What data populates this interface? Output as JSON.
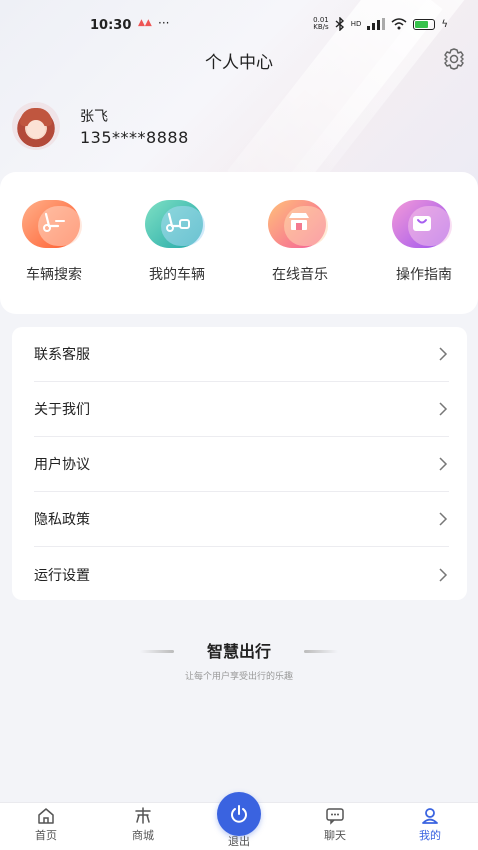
{
  "status_bar": {
    "time": "10:30",
    "alert_icon": "carrier-alert-icon",
    "dots": "···",
    "network_speed_value": "0.01",
    "network_speed_unit": "KB/s",
    "signal": "HD"
  },
  "header": {
    "title": "个人中心",
    "settings_icon": "gear-icon"
  },
  "user": {
    "name": "张飞",
    "phone": "135****8888"
  },
  "quick_actions": [
    {
      "label": "车辆搜索",
      "icon": "scooter-search-icon",
      "color_a": "#ff6a3d",
      "color_b": "#ffc3a6"
    },
    {
      "label": "我的车辆",
      "icon": "scooter-icon",
      "color_a": "#2bb7a8",
      "color_b": "#9fd3f3"
    },
    {
      "label": "在线音乐",
      "icon": "store-icon",
      "color_a": "#f56b9a",
      "color_b": "#ffc58d"
    },
    {
      "label": "操作指南",
      "icon": "shopping-bag-icon",
      "color_a": "#a65ef0",
      "color_b": "#f2a6dc"
    }
  ],
  "menu": [
    {
      "label": "联系客服"
    },
    {
      "label": "关于我们"
    },
    {
      "label": "用户协议"
    },
    {
      "label": "隐私政策"
    },
    {
      "label": "运行设置"
    }
  ],
  "brand": {
    "title": "智慧出行",
    "subtitle": "让每个用户享受出行的乐趣"
  },
  "tabbar": {
    "items": [
      {
        "label": "首页",
        "icon": "home-icon"
      },
      {
        "label": "商城",
        "icon": "shop-icon"
      },
      {
        "label": "退出",
        "icon": "power-icon"
      },
      {
        "label": "聊天",
        "icon": "chat-icon"
      },
      {
        "label": "我的",
        "icon": "user-icon"
      }
    ],
    "active_index": 4,
    "accent": "#3a63e0"
  }
}
